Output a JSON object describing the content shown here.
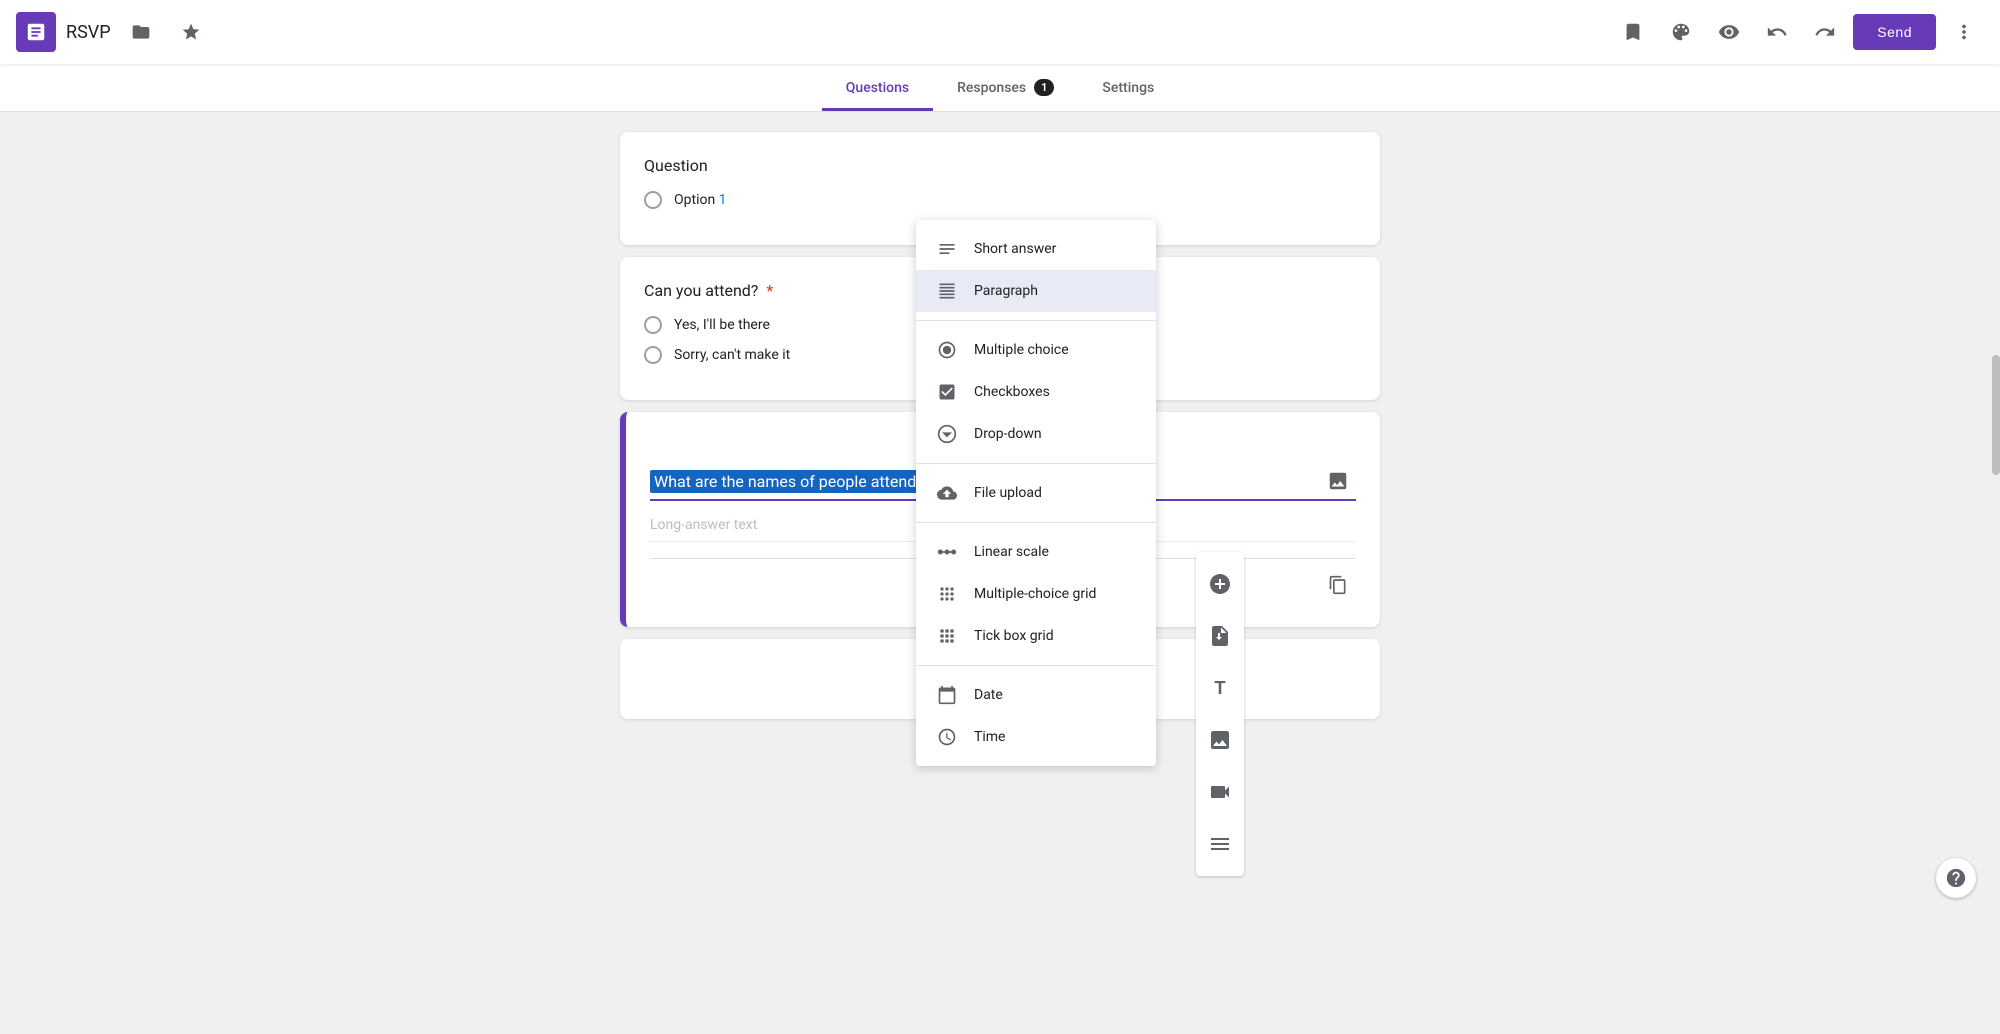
{
  "app": {
    "title": "RSVP",
    "send_label": "Send"
  },
  "tabs": [
    {
      "label": "Questions",
      "active": true,
      "badge": null
    },
    {
      "label": "Responses",
      "active": false,
      "badge": "1"
    },
    {
      "label": "Settings",
      "active": false,
      "badge": null
    }
  ],
  "cards": [
    {
      "id": "card1",
      "question_label": "Question",
      "options": [
        {
          "text": "Option",
          "suffix": "1",
          "suffix_colored": true
        }
      ]
    },
    {
      "id": "card2",
      "question_label": "Can you attend?",
      "required": true,
      "options": [
        {
          "text": "Yes,  I'll be there"
        },
        {
          "text": "Sorry, can't make it"
        }
      ]
    },
    {
      "id": "card3",
      "active": true,
      "question_value": "What are the names of people attending?",
      "placeholder_answer": "Long-answer text",
      "image_btn_title": "Add image"
    }
  ],
  "card_partial": {
    "visible": true
  },
  "dropdown": {
    "items": [
      {
        "id": "short-answer",
        "label": "Short answer",
        "icon": "short-answer"
      },
      {
        "id": "paragraph",
        "label": "Paragraph",
        "icon": "paragraph",
        "selected": true
      },
      {
        "divider": false
      },
      {
        "id": "multiple-choice",
        "label": "Multiple choice",
        "icon": "multiple-choice"
      },
      {
        "id": "checkboxes",
        "label": "Checkboxes",
        "icon": "checkboxes"
      },
      {
        "id": "drop-down",
        "label": "Drop-down",
        "icon": "dropdown"
      },
      {
        "divider": true
      },
      {
        "id": "file-upload",
        "label": "File upload",
        "icon": "file-upload"
      },
      {
        "divider": true
      },
      {
        "id": "linear-scale",
        "label": "Linear scale",
        "icon": "linear-scale"
      },
      {
        "id": "multiple-choice-grid",
        "label": "Multiple-choice grid",
        "icon": "mc-grid"
      },
      {
        "id": "tick-box-grid",
        "label": "Tick box grid",
        "icon": "tick-grid"
      },
      {
        "divider": true
      },
      {
        "id": "date",
        "label": "Date",
        "icon": "date"
      },
      {
        "id": "time",
        "label": "Time",
        "icon": "time"
      }
    ]
  },
  "fab": {
    "buttons": [
      {
        "id": "add-question",
        "icon": "➕",
        "title": "Add question"
      },
      {
        "id": "import-question",
        "icon": "📄",
        "title": "Import questions"
      },
      {
        "id": "add-title",
        "icon": "T",
        "title": "Add title and description"
      },
      {
        "id": "add-image",
        "icon": "🖼",
        "title": "Add image"
      },
      {
        "id": "add-video",
        "icon": "▶",
        "title": "Add video"
      },
      {
        "id": "add-section",
        "icon": "☰",
        "title": "Add section"
      }
    ]
  },
  "topbar": {
    "icons": [
      {
        "id": "palette",
        "symbol": "🎨",
        "title": "Customize theme"
      },
      {
        "id": "preview",
        "symbol": "👁",
        "title": "Preview"
      },
      {
        "id": "undo",
        "symbol": "↩",
        "title": "Undo"
      },
      {
        "id": "redo",
        "symbol": "↪",
        "title": "Redo"
      },
      {
        "id": "more",
        "symbol": "⋮",
        "title": "More options"
      }
    ],
    "bookmark_icon": "🔖"
  }
}
